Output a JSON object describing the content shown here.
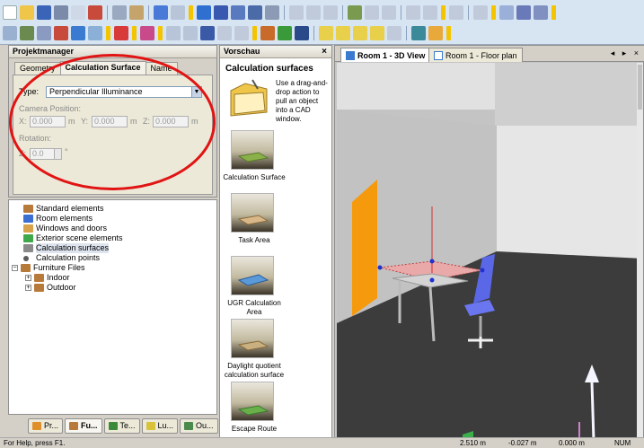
{
  "colors": {
    "accent": "#e11414",
    "floor": "#3c3c3c",
    "wall_left": "#cfcfcf",
    "wall_back": "#e3e3e3",
    "door": "#f59a0c",
    "calc_surface": "#e9a9a9",
    "chair": "#5a67e6"
  },
  "toolbar": {
    "row1_icons": [
      "new-icon",
      "open-icon",
      "save-icon",
      "print-icon",
      "preview-icon",
      "cut-icon",
      "copy-icon",
      "paste-icon",
      "undo-icon",
      "redo-icon",
      "room-icon",
      "elements-icon",
      "luminaires-icon",
      "calc-icon",
      "gear-icon",
      "grid-icon",
      "rect-icon",
      "polygon-icon",
      "layout-icon"
    ],
    "row2_icons": [
      "select-icon",
      "pointer-icon",
      "rotate-icon",
      "view-icon",
      "zoom-icon",
      "pan-icon",
      "camera-icon",
      "light-icon",
      "color-icon",
      "measure-icon",
      "points-icon",
      "surface-icon",
      "tree-icon"
    ]
  },
  "projektmanager": {
    "title": "Projektmanager",
    "tabs": [
      {
        "label": "Geometry"
      },
      {
        "label": "Calculation Surface"
      },
      {
        "label": "Name"
      }
    ],
    "type_label": "Type:",
    "type_value": "Perpendicular Illuminance",
    "camera_label": "Camera Position:",
    "x_label": "X:",
    "x_value": "0.000",
    "x_unit": "m",
    "y_label": "Y:",
    "y_value": "0.000",
    "y_unit": "m",
    "z_label": "Z:",
    "z_value": "0.000",
    "z_unit": "m",
    "rotation_label": "Rotation:",
    "rot_axis": "Z:",
    "rot_value": "0.0",
    "rot_unit": "°"
  },
  "tree": {
    "items": [
      {
        "label": "Standard elements",
        "icon": "furniture-icon",
        "color": "#b87a3a"
      },
      {
        "label": "Room elements",
        "icon": "room-element-icon",
        "color": "#3a6fd1"
      },
      {
        "label": "Windows and doors",
        "icon": "door-icon",
        "color": "#d8a24a"
      },
      {
        "label": "Exterior scene elements",
        "icon": "tree-icon",
        "color": "#3fa84a"
      },
      {
        "label": "Calculation surfaces",
        "icon": "surface-icon",
        "color": "#8a8a8a"
      },
      {
        "label": "Calculation points",
        "icon": "points-icon",
        "color": "#5c5c5c"
      },
      {
        "label": "Furniture Files",
        "icon": "folder-icon",
        "color": "#b87a3a"
      },
      {
        "label": "Indoor",
        "icon": "folder-icon",
        "color": "#b87a3a"
      },
      {
        "label": "Outdoor",
        "icon": "folder-icon",
        "color": "#b87a3a"
      }
    ],
    "expand_symbol": "+",
    "collapse_symbol": "−"
  },
  "bottom_tabs": [
    {
      "label": "Pr...",
      "icon": "project-icon",
      "color": "#e0902a"
    },
    {
      "label": "Fu...",
      "icon": "furniture-icon",
      "color": "#b87a3a"
    },
    {
      "label": "Te...",
      "icon": "texture-icon",
      "color": "#3a8a3a"
    },
    {
      "label": "Lu...",
      "icon": "luminaire-icon",
      "color": "#d8c23a"
    },
    {
      "label": "Ou...",
      "icon": "output-icon",
      "color": "#4a8a4a"
    }
  ],
  "vorschau": {
    "title": "Vorschau",
    "close": "×",
    "heading": "Calculation surfaces",
    "hint": "Use a drag-and-drop action to pull an object into a CAD window.",
    "thumbs": [
      {
        "label": "Calculation Surface"
      },
      {
        "label": "Task Area"
      },
      {
        "label": "UGR Calculation Area"
      },
      {
        "label": "Daylight quotient calculation surface"
      },
      {
        "label": "Escape Route"
      }
    ]
  },
  "view": {
    "tabs": [
      {
        "label": "Room 1 - 3D View"
      },
      {
        "label": "Room 1 - Floor plan"
      }
    ],
    "nav": "◂ ▸ ×"
  },
  "status": {
    "help": "For Help, press F1.",
    "x": "2.510 m",
    "y": "-0.027 m",
    "z": "0.000 m",
    "mode": "NUM"
  }
}
